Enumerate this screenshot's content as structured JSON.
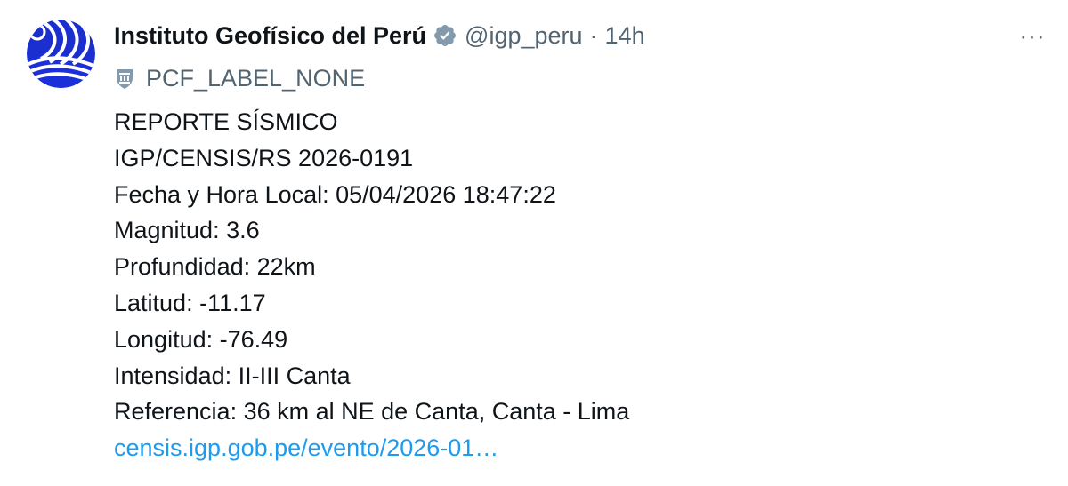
{
  "author": {
    "name": "Instituto Geofísico del Perú",
    "handle": "@igp_peru",
    "separator": "·",
    "time": "14h",
    "verified_icon": "verified-badge-icon",
    "avatar_icon": "igp-logo"
  },
  "label": {
    "icon": "government-label-icon",
    "text": "PCF_LABEL_NONE"
  },
  "more_button": {
    "label": "···",
    "icon": "more-options-icon"
  },
  "tweet_lines": [
    "REPORTE SÍSMICO",
    "IGP/CENSIS/RS 2026-0191",
    "Fecha y Hora Local: 05/04/2026 18:47:22",
    "Magnitud: 3.6",
    "Profundidad: 22km",
    "Latitud: -11.17",
    "Longitud: -76.49",
    "Intensidad: II-III Canta",
    "Referencia: 36 km al NE de Canta, Canta - Lima"
  ],
  "link": {
    "text": "censis.igp.gob.pe/evento/2026-01…"
  },
  "colors": {
    "text_primary": "#0f1419",
    "text_secondary": "#536471",
    "link": "#1d9bf0",
    "verified": "#829aab",
    "avatar_blue": "#2035d6"
  }
}
